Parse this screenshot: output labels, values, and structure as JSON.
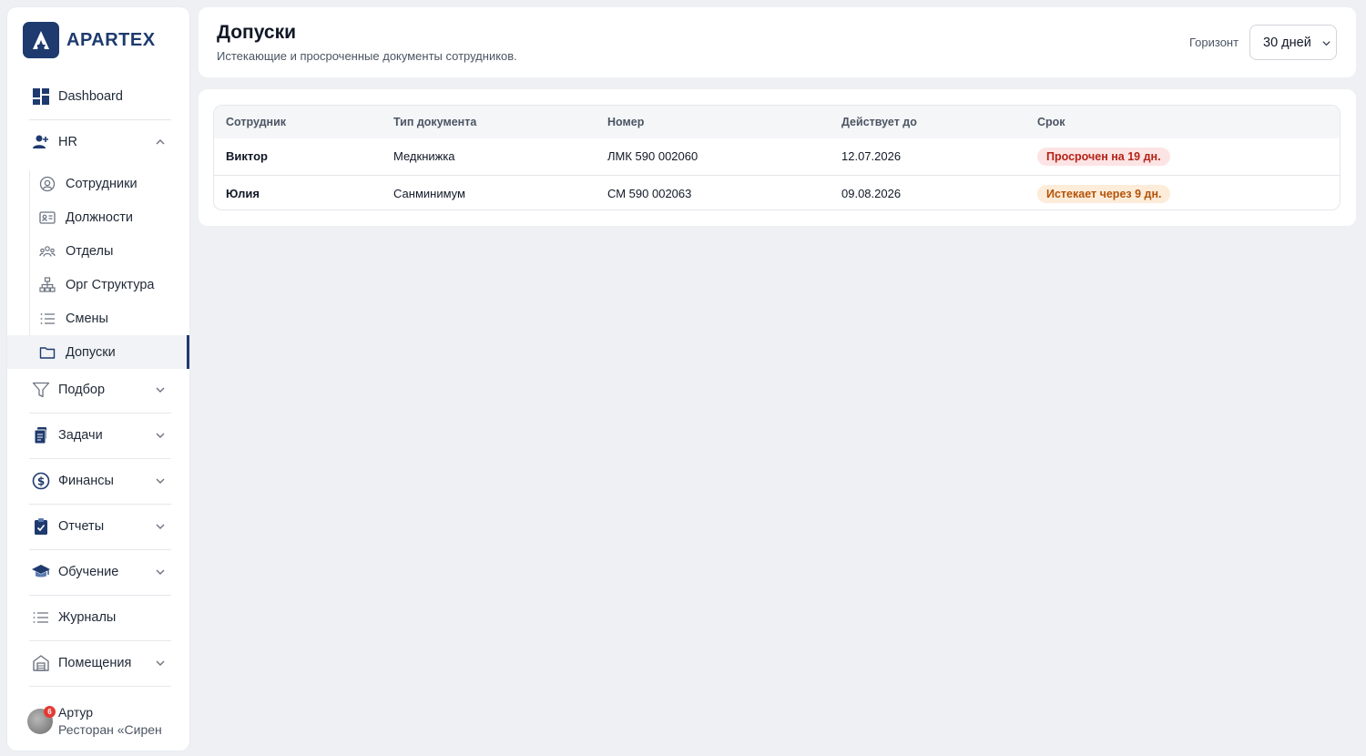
{
  "app": {
    "brand": "APARTEX"
  },
  "sidebar": {
    "dashboard": "Dashboard",
    "hr": {
      "label": "HR",
      "items": [
        {
          "label": "Сотрудники",
          "icon": "user-circle-icon"
        },
        {
          "label": "Должности",
          "icon": "id-card-icon"
        },
        {
          "label": "Отделы",
          "icon": "users-group-icon"
        },
        {
          "label": "Орг Структура",
          "icon": "org-chart-icon"
        },
        {
          "label": "Смены",
          "icon": "list-icon"
        },
        {
          "label": "Допуски",
          "icon": "folder-icon",
          "active": true
        }
      ]
    },
    "sections": [
      {
        "label": "Подбор",
        "icon": "funnel-icon"
      },
      {
        "label": "Задачи",
        "icon": "clipboard-icon"
      },
      {
        "label": "Финансы",
        "icon": "dollar-icon"
      },
      {
        "label": "Отчеты",
        "icon": "report-icon"
      },
      {
        "label": "Обучение",
        "icon": "graduation-cap-icon"
      },
      {
        "label": "Журналы",
        "icon": "list-icon"
      },
      {
        "label": "Помещения",
        "icon": "building-icon"
      }
    ],
    "user": {
      "name": "Артур",
      "org": "Ресторан «Сирен",
      "notifications": "6"
    }
  },
  "header": {
    "title": "Допуски",
    "subtitle": "Истекающие и просроченные документы сотрудников.",
    "horizon_label": "Горизонт",
    "horizon_value": "30 дней"
  },
  "table": {
    "columns": [
      "Сотрудник",
      "Тип документа",
      "Номер",
      "Действует до",
      "Срок"
    ],
    "rows": [
      {
        "employee": "Виктор",
        "doc_type": "Медкнижка",
        "number": "ЛМК 590 002060",
        "valid_until": "12.07.2026",
        "status": "Просрочен на 19 дн.",
        "status_kind": "overdue"
      },
      {
        "employee": "Юлия",
        "doc_type": "Санминимум",
        "number": "СМ 590 002063",
        "valid_until": "09.08.2026",
        "status": "Истекает через 9 дн.",
        "status_kind": "expiring"
      }
    ]
  },
  "colors": {
    "brand": "#1e3a6e",
    "overdue": "#b42318",
    "expiring": "#b45309"
  }
}
